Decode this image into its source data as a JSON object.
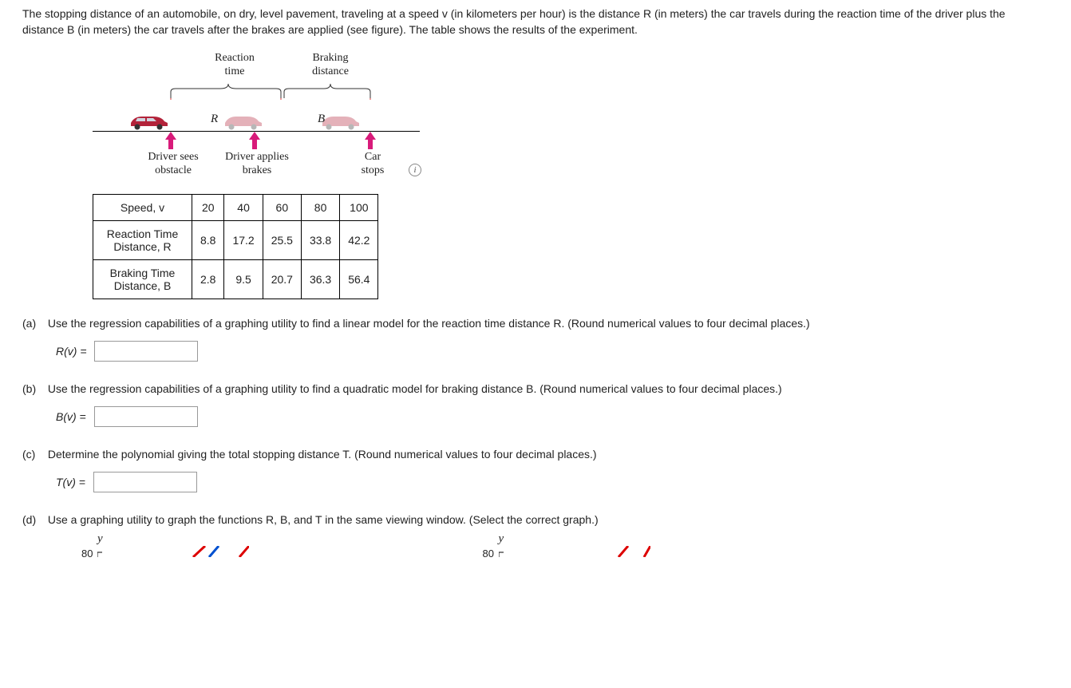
{
  "problem": {
    "intro": "The stopping distance of an automobile, on dry, level pavement, traveling at a speed v (in kilometers per hour) is the distance R (in meters) the car travels during the reaction time of the driver plus the distance B (in meters) the car travels after the brakes are applied (see figure). The table shows the results of the experiment."
  },
  "figure": {
    "top_left": "Reaction\ntime",
    "top_right": "Braking\ndistance",
    "seg_R": "R",
    "seg_B": "B",
    "bl_left": "Driver sees\nobstacle",
    "bl_mid": "Driver applies\nbrakes",
    "bl_right": "Car\nstops"
  },
  "table": {
    "row0_head": "Speed, v",
    "row1_head": "Reaction Time Distance, R",
    "row2_head": "Braking Time Distance, B",
    "speeds": [
      "20",
      "40",
      "60",
      "80",
      "100"
    ],
    "R": [
      "8.8",
      "17.2",
      "25.5",
      "33.8",
      "42.2"
    ],
    "B": [
      "2.8",
      "9.5",
      "20.7",
      "36.3",
      "56.4"
    ]
  },
  "parts": {
    "a": {
      "label": "(a)",
      "text": "Use the regression capabilities of a graphing utility to find a linear model for the reaction time distance R. (Round numerical values to four decimal places.)",
      "eq": "R(v) ="
    },
    "b": {
      "label": "(b)",
      "text": "Use the regression capabilities of a graphing utility to find a quadratic model for braking distance B. (Round numerical values to four decimal places.)",
      "eq": "B(v) ="
    },
    "c": {
      "label": "(c)",
      "text": "Determine the polynomial giving the total stopping distance T. (Round numerical values to four decimal places.)",
      "eq": "T(v) ="
    },
    "d": {
      "label": "(d)",
      "text": "Use a graphing utility to graph the functions R, B, and T in the same viewing window. (Select the correct graph.)",
      "y": "y",
      "tick": "80"
    }
  }
}
